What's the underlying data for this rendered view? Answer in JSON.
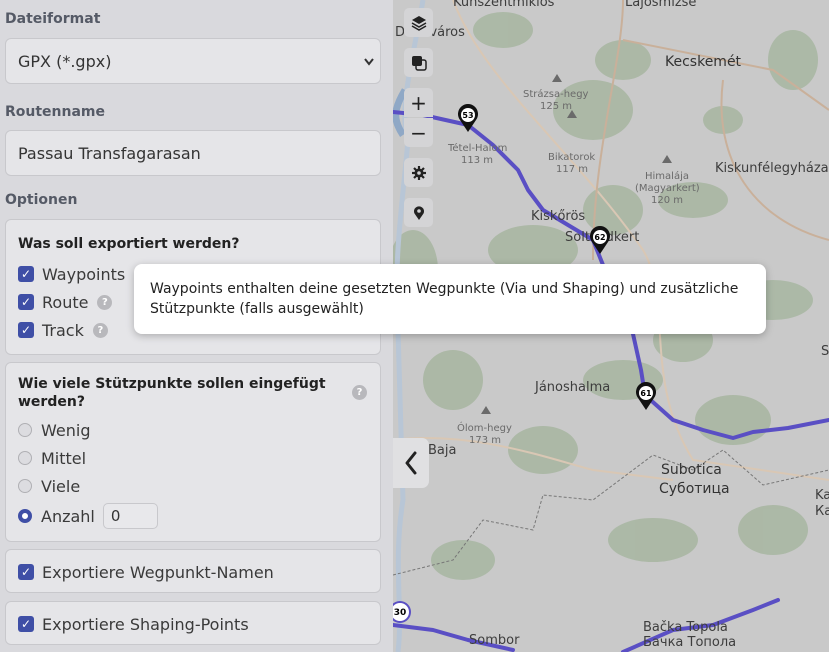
{
  "panel": {
    "file_format": {
      "label": "Dateiformat",
      "value": "GPX (*.gpx)"
    },
    "route_name": {
      "label": "Routenname",
      "value": "Passau Transfagarasan"
    },
    "options": {
      "label": "Optionen",
      "export_group": {
        "title": "Was soll exportiert werden?",
        "items": [
          {
            "label": "Waypoints",
            "checked": true
          },
          {
            "label": "Route",
            "checked": true,
            "help": "?"
          },
          {
            "label": "Track",
            "checked": true,
            "help": "?"
          }
        ]
      },
      "support_points": {
        "title": "Wie viele Stützpunkte sollen eingefügt werden?",
        "help": "?",
        "choices": [
          {
            "label": "Wenig",
            "selected": false
          },
          {
            "label": "Mittel",
            "selected": false
          },
          {
            "label": "Viele",
            "selected": false
          },
          {
            "label": "Anzahl",
            "selected": true
          }
        ],
        "count_value": "0"
      },
      "export_waypoint_names": {
        "label": "Exportiere Wegpunkt-Namen",
        "checked": true
      },
      "export_shaping_points": {
        "label": "Exportiere Shaping-Points",
        "checked": true
      }
    }
  },
  "tooltip": {
    "text": "Waypoints enthalten deine gesetzten Wegpunkte (Via und Shaping) und zusätzliche Stützpunkte (falls ausgewählt)"
  },
  "map": {
    "controls": [
      "layers-icon",
      "overlay-icon",
      "+",
      "−",
      "settings-icon",
      "location-icon"
    ],
    "markers": [
      "53",
      "62",
      "61",
      "30"
    ],
    "labels": {
      "kunszentmiklos": "Kunszentmiklós",
      "lajosmizse": "Lajosmizse",
      "dunavaros": "Dunaváros",
      "kecskemet": "Kecskemét",
      "straza": "Strázsa-hegy",
      "straza_h": "125 m",
      "tetel": "Tétel-Halom",
      "tetel_h": "113 m",
      "bikatorok": "Bikatorok",
      "bikatorok_h": "117 m",
      "himalaja": "Himalája",
      "himalaja2": "(Magyarkert)",
      "himalaja_h": "120 m",
      "kiskunfelegyhaza": "Kiskunfélegyháza",
      "kiskoros": "Kiskőrös",
      "soltvadkert": "Soltvadkert",
      "janoshalma": "Jánoshalma",
      "olom": "Ólom-hegy",
      "olom_h": "173 m",
      "baja": "Baja",
      "subotica": "Subotica",
      "subotica_cyr": "Суботица",
      "sombor": "Sombor",
      "backa": "Bačka Topola",
      "backa_cyr": "Бачка Топола",
      "ka": "Ka",
      "ka_cyr": "Кан",
      "s": "S"
    },
    "route_color": "#5a4fc4"
  }
}
